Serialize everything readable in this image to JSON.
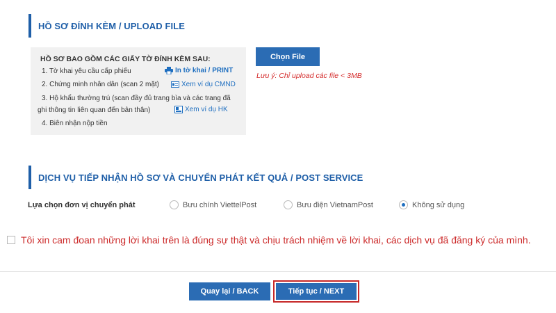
{
  "upload_section": {
    "title": "HỒ SƠ ĐÍNH KÈM / UPLOAD FILE",
    "docs_heading": "HỒ SƠ BAO GỒM CÁC GIẤY TỜ ĐÍNH KÈM SAU:",
    "items": [
      "1. Tờ khai yêu cầu cấp phiếu",
      "2. Chứng minh nhân dân (scan 2 mặt)",
      "3. Hộ khẩu thường trú (scan đầy đủ trang bìa và các trang đã",
      "ghi thông tin liên quan đến bản thân)",
      "4. Biên nhận nộp tiền"
    ],
    "print_link": "In tờ khai / PRINT",
    "cmnd_link": "Xem ví dụ CMND",
    "hk_link": "Xem ví dụ HK",
    "choose_file_label": "Chọn File",
    "note": "Lưu ý: Chỉ upload các file < 3MB"
  },
  "post_section": {
    "title": "DỊCH VỤ TIẾP NHẬN HỒ SƠ VÀ CHUYỂN PHÁT KẾT QUẢ / POST SERVICE",
    "field_label": "Lựa chọn đơn vị chuyển phát",
    "options": [
      "Bưu chính ViettelPost",
      "Bưu điện VietnamPost",
      "Không sử dụng"
    ],
    "selected": "Không sử dụng"
  },
  "agreement": {
    "text": "Tôi xin cam đoan những lời khai trên là đúng sự thật và chịu trách nhiệm về lời khai, các dịch vụ đã đăng ký của mình.",
    "checked": false
  },
  "actions": {
    "back_label": "Quay lại / BACK",
    "next_label": "Tiếp tục / NEXT"
  },
  "colors": {
    "brand_blue": "#2b6cb4",
    "warning_red": "#d42b2b",
    "highlight_border": "#c62828"
  }
}
